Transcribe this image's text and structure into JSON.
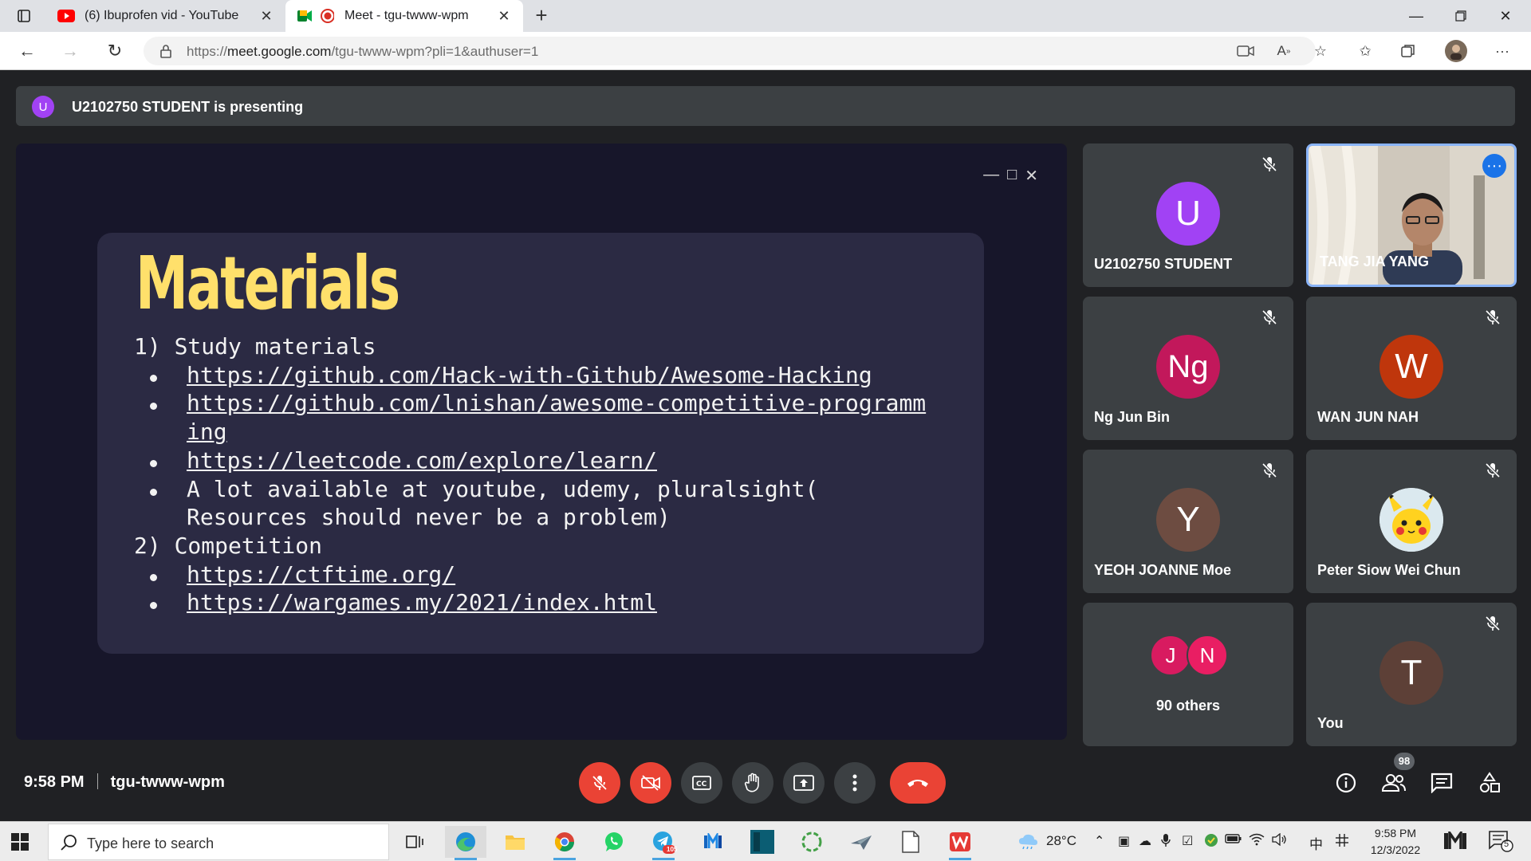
{
  "browser": {
    "tabs": [
      {
        "title": "(6) Ibuprofen vid - YouTube",
        "active": false
      },
      {
        "title": "Meet - tgu-twww-wpm",
        "active": true
      }
    ],
    "url_prefix": "https://",
    "url_host": "meet.google.com",
    "url_rest": "/tgu-twww-wpm?pli=1&authuser=1"
  },
  "meet": {
    "presenting_initial": "U",
    "presenting_text": "U2102750 STUDENT is presenting",
    "slide": {
      "title": "Materials",
      "lines": [
        {
          "text": "1) Study materials",
          "bullet": false,
          "link": false
        },
        {
          "text": "https://github.com/Hack-with-Github/Awesome-Hacking",
          "bullet": true,
          "link": true
        },
        {
          "text": "https://github.com/lnishan/awesome-competitive-programm",
          "bullet": true,
          "link": true
        },
        {
          "text": "ing",
          "bullet": false,
          "link": true
        },
        {
          "text": "https://leetcode.com/explore/learn/",
          "bullet": true,
          "link": true
        },
        {
          "text": "A lot available at youtube, udemy, pluralsight(",
          "bullet": true,
          "link": false
        },
        {
          "text": "Resources should never be a problem)",
          "bullet": false,
          "link": false
        },
        {
          "text": "2) Competition",
          "bullet": false,
          "link": false
        },
        {
          "text": "https://ctftime.org/",
          "bullet": true,
          "link": true
        },
        {
          "text": "https://wargames.my/2021/index.html",
          "bullet": true,
          "link": true
        }
      ]
    },
    "participants": [
      {
        "name": "U2102750 STUDENT",
        "initial": "U",
        "color": "#a142f4",
        "muted": true
      },
      {
        "name": "TANG JIA YANG",
        "video": true
      },
      {
        "name": "Ng Jun Bin",
        "initial": "Ng",
        "color": "#c2185b",
        "muted": true
      },
      {
        "name": "WAN JUN NAH",
        "initial": "W",
        "color": "#bf360c",
        "muted": true
      },
      {
        "name": "YEOH JOANNE Moe",
        "initial": "Y",
        "color": "#6d4c41",
        "muted": true
      },
      {
        "name": "Peter Siow Wei Chun",
        "avatar_icon": "pikachu-avatar-icon",
        "muted": true
      },
      {
        "name": "90 others",
        "initials": [
          "J",
          "N"
        ],
        "colors": [
          "#d81b60",
          "#e91e63"
        ]
      },
      {
        "name": "You",
        "initial": "T",
        "color": "#5d4037",
        "muted": true
      }
    ],
    "time": "9:58 PM",
    "meeting_code": "tgu-twww-wpm",
    "people_count": "98",
    "colors": {
      "end_call": "#ea4335",
      "accent": "#1a73e8",
      "slide_title": "#ffe06b"
    }
  },
  "taskbar": {
    "search_placeholder": "Type here to search",
    "telegram_badge": "105",
    "weather": "28°C",
    "ime": "中",
    "clock_time": "9:58 PM",
    "clock_date": "12/3/2022",
    "notification_count": "5"
  }
}
